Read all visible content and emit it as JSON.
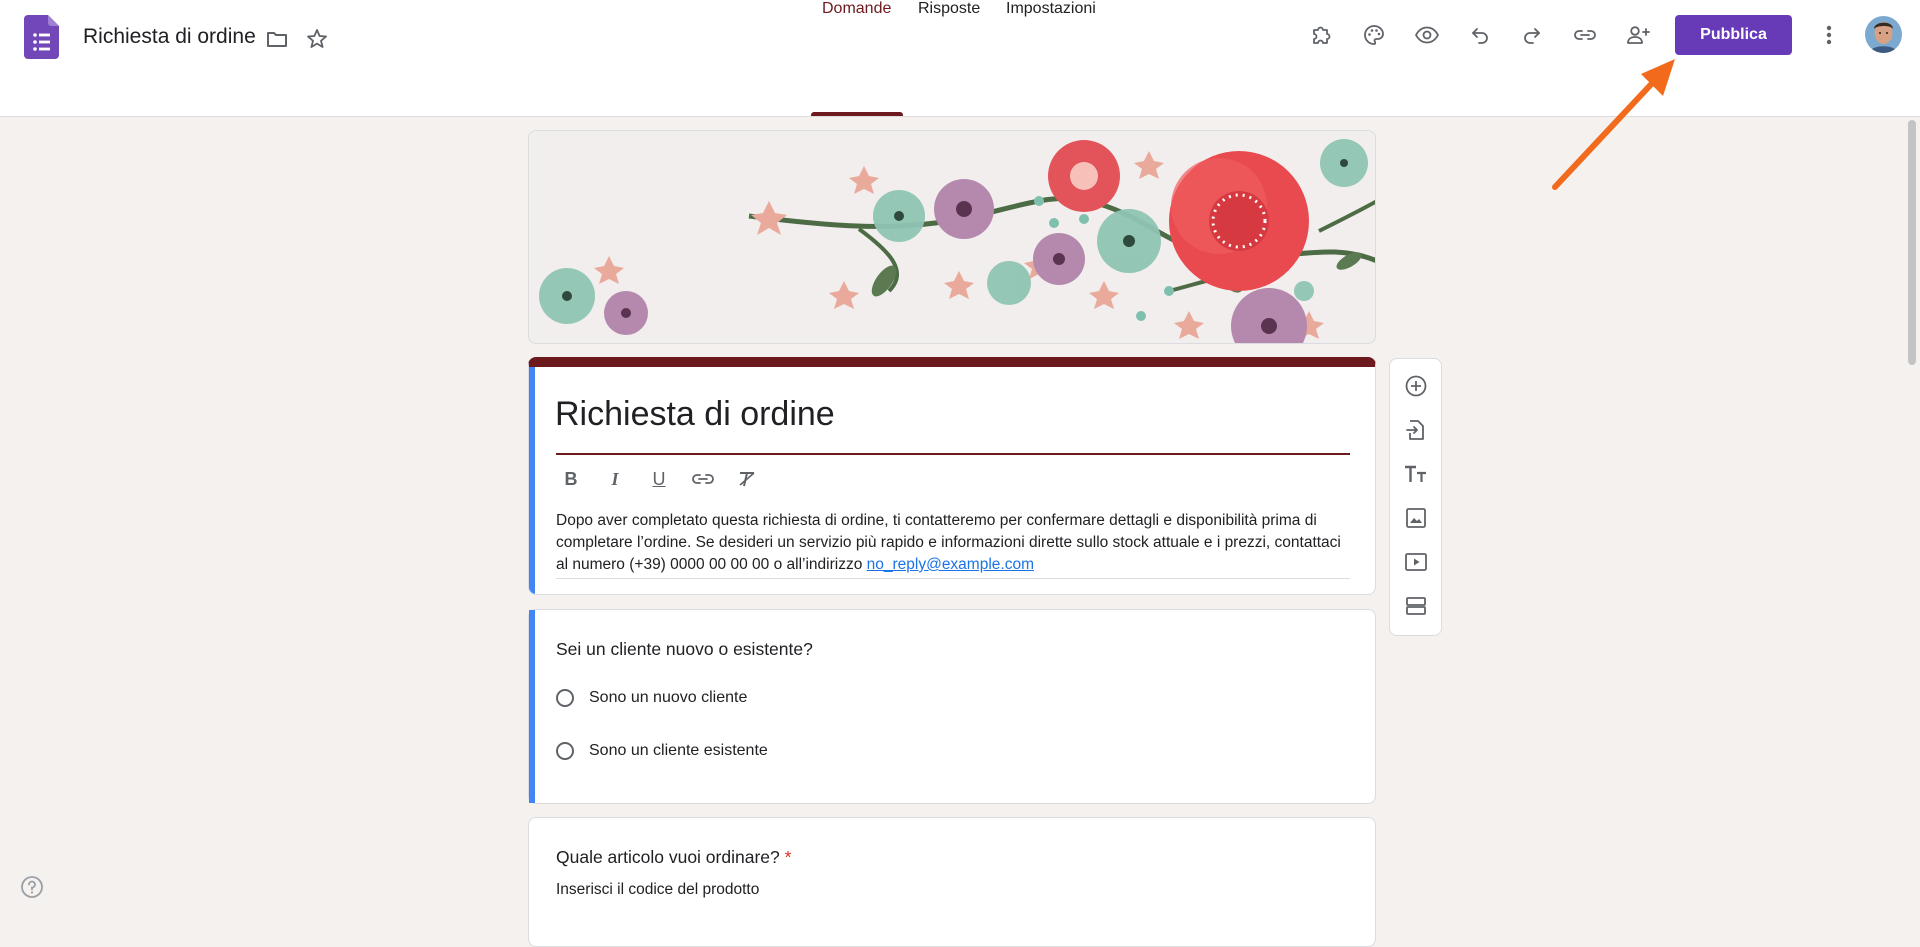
{
  "header": {
    "doc_title": "Richiesta di ordine",
    "publish_label": "Pubblica",
    "icons": [
      "forms-logo-icon",
      "folder-icon",
      "star-icon",
      "puzzle-addon-icon",
      "palette-icon",
      "eye-preview-icon",
      "undo-icon",
      "redo-icon",
      "link-icon",
      "add-person-icon",
      "more-vert-icon"
    ]
  },
  "tabs": [
    {
      "label": "Domande"
    },
    {
      "label": "Risposte"
    },
    {
      "label": "Impostazioni"
    }
  ],
  "form": {
    "title": "Richiesta di ordine",
    "description": "Dopo aver completato questa richiesta di ordine, ti contatteremo per confermare dettagli e disponibilità prima di completare l’ordine. Se desideri un servizio più rapido e informazioni dirette sullo stock attuale e i prezzi, contattaci al numero (+39) 0000 00 00 00 o all’indirizzo ",
    "email": "no_reply@example.com"
  },
  "questions": [
    {
      "title": "Sei un cliente nuovo o esistente?",
      "options": [
        "Sono un nuovo cliente",
        "Sono un cliente esistente"
      ]
    },
    {
      "title": "Quale articolo vuoi ordinare?",
      "required_mark": "*",
      "subtitle": "Inserisci il codice del prodotto"
    }
  ],
  "colors": {
    "accent": "#673ab7",
    "theme": "#6d1a1f",
    "focus": "#4285f4",
    "arrow": "#f26b1d"
  }
}
